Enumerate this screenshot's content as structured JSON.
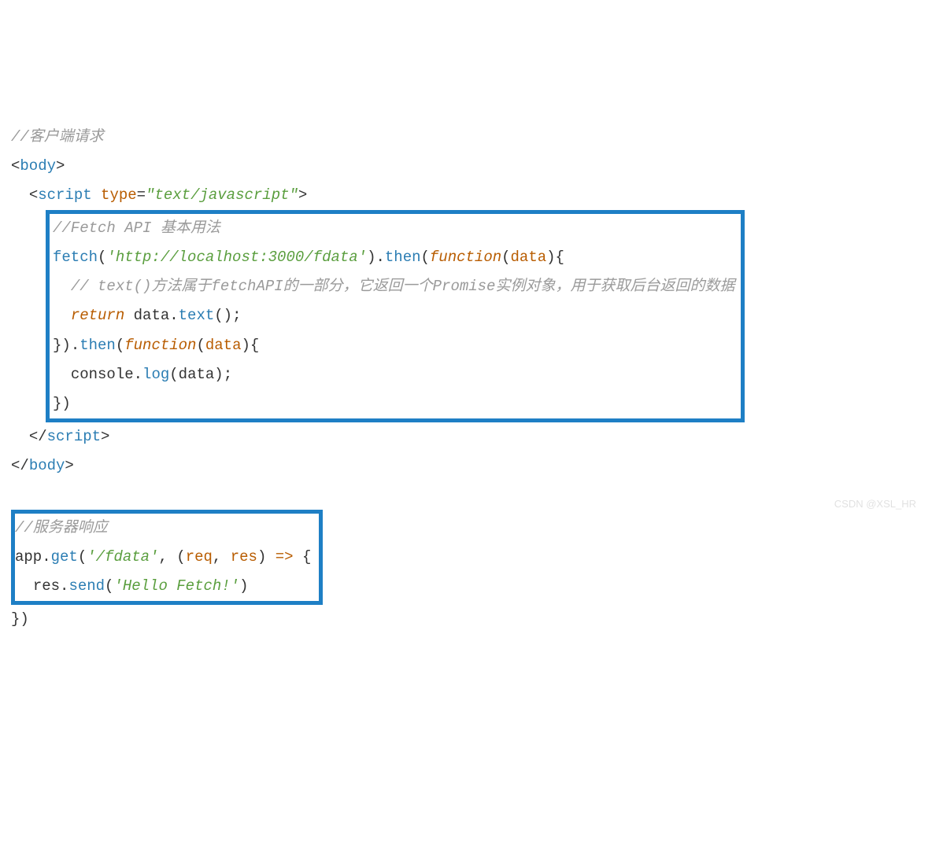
{
  "block1": {
    "c_client": "//客户端请求",
    "body_open": "body",
    "script_open_tag": "script",
    "script_attr_name": "type",
    "script_attr_eq": "=",
    "script_attr_val": "\"text/javascript\"",
    "gt": ">",
    "lt": "<",
    "slash": "/",
    "indent1": "  ",
    "indent2": "    ",
    "c_fetch_api": "//Fetch API 基本用法",
    "fetch": "fetch",
    "paren_l": "(",
    "paren_r": ")",
    "url": "'http://localhost:3000/fdata'",
    "dot": ".",
    "then": "then",
    "function_kw": "function",
    "data_param": "data",
    "brace_l": "{",
    "brace_r": "}",
    "c_text_method": "// text()方法属于fetchAPI的一部分，它返回一个Promise实例对象，用于获取后台返回的数据",
    "return_kw": "return",
    "sp": " ",
    "data_ident": "data",
    "text_fn": "text",
    "semicolon": ";",
    "console_ident": "console",
    "log_fn": "log",
    "script_close": "script",
    "body_close": "body"
  },
  "block2": {
    "c_server": "//服务器响应",
    "app_ident": "app",
    "dot": ".",
    "get_fn": "get",
    "paren_l": "(",
    "paren_r": ")",
    "route": "'/fdata'",
    "comma_sp": ", ",
    "req": "req",
    "res": "res",
    "arrow": " => ",
    "brace_l": "{",
    "brace_r": "}",
    "indent": "  ",
    "res_ident": "res",
    "send_fn": "send",
    "msg": "'Hello Fetch!'",
    "close_paren": ")"
  },
  "watermark": "CSDN @XSL_HR"
}
